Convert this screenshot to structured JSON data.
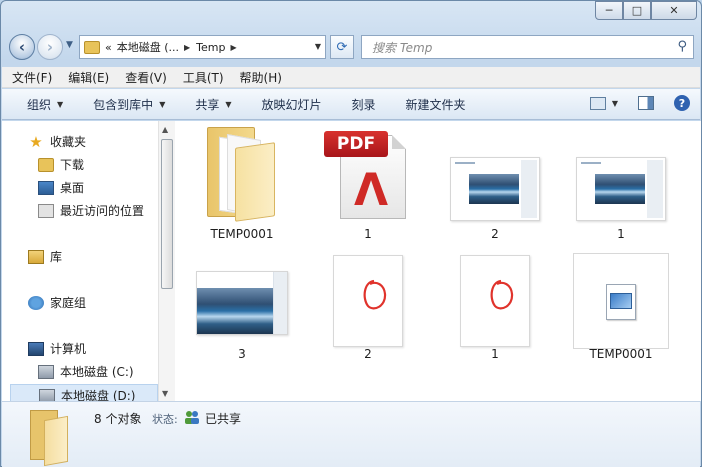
{
  "window": {
    "caption_buttons": {
      "minimize": "─",
      "maximize": "□",
      "close": "✕"
    }
  },
  "address": {
    "prefix": "«",
    "segments": [
      "本地磁盘 (...",
      "Temp"
    ],
    "search_placeholder": "搜索 Temp"
  },
  "menubar": {
    "items": [
      "文件(F)",
      "编辑(E)",
      "查看(V)",
      "工具(T)",
      "帮助(H)"
    ]
  },
  "commandbar": {
    "items": [
      {
        "label": "组织",
        "dropdown": true
      },
      {
        "label": "包含到库中",
        "dropdown": true
      },
      {
        "label": "共享",
        "dropdown": true
      },
      {
        "label": "放映幻灯片",
        "dropdown": false
      },
      {
        "label": "刻录",
        "dropdown": false
      },
      {
        "label": "新建文件夹",
        "dropdown": false
      }
    ]
  },
  "navpane": {
    "items": [
      {
        "label": "收藏夹",
        "icon": "star-icon"
      },
      {
        "label": "下载",
        "icon": "downloads-folder-icon"
      },
      {
        "label": "桌面",
        "icon": "desktop-icon"
      },
      {
        "label": "最近访问的位置",
        "icon": "recent-places-icon"
      },
      {
        "label": "库",
        "icon": "libraries-icon"
      },
      {
        "label": "家庭组",
        "icon": "homegroup-icon"
      },
      {
        "label": "计算机",
        "icon": "computer-icon"
      },
      {
        "label": "本地磁盘 (C:)",
        "icon": "drive-icon"
      },
      {
        "label": "本地磁盘 (D:)",
        "icon": "drive-icon",
        "selected": true
      }
    ]
  },
  "files": [
    {
      "name": "TEMP0001",
      "type": "folder"
    },
    {
      "name": "1",
      "type": "pdf",
      "tag": "PDF"
    },
    {
      "name": "2",
      "type": "screenshot"
    },
    {
      "name": "1",
      "type": "screenshot"
    },
    {
      "name": "3",
      "type": "screenshot-wide"
    },
    {
      "name": "2",
      "type": "drawing"
    },
    {
      "name": "1",
      "type": "drawing"
    },
    {
      "name": "TEMP0001",
      "type": "tmp-file"
    }
  ],
  "details": {
    "count": "8 个对象",
    "state_label": "状态:",
    "state_value": "已共享"
  },
  "colors": {
    "accent": "#2f62b0",
    "selection": "#dae9f9",
    "pdf_red": "#cf2a26",
    "drawing_red": "#e0332c"
  }
}
